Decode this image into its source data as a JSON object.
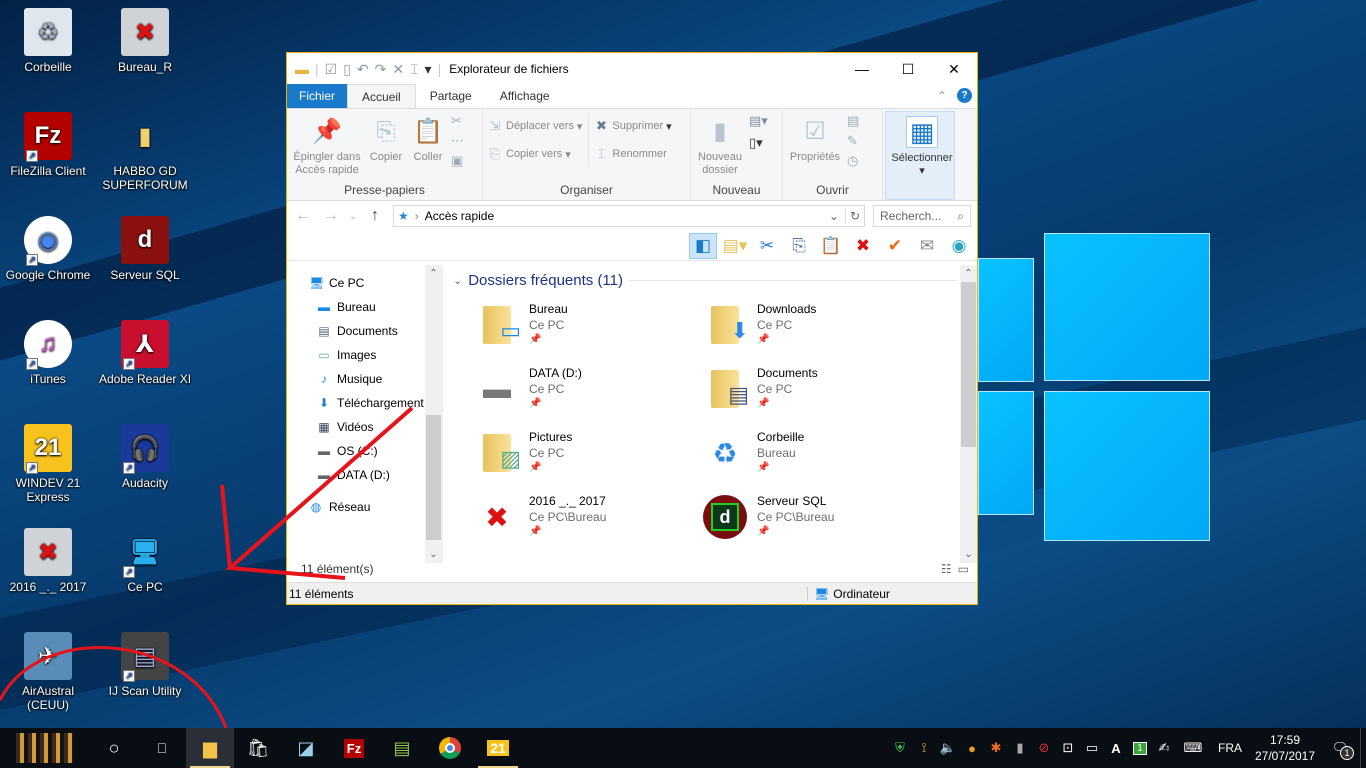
{
  "desktop": {
    "icons": [
      {
        "label": "Corbeille",
        "icon": "recycle-bin-icon",
        "shortcut": false
      },
      {
        "label": "Bureau_R",
        "icon": "disconnected-drive-icon",
        "shortcut": false
      },
      {
        "label": "FileZilla Client",
        "icon": "filezilla-icon",
        "shortcut": true
      },
      {
        "label": "HABBO GD SUPERFORUM",
        "icon": "folder-icon",
        "shortcut": false
      },
      {
        "label": "Google Chrome",
        "icon": "chrome-icon",
        "shortcut": true
      },
      {
        "label": "Serveur SQL",
        "icon": "sql-server-icon",
        "shortcut": false
      },
      {
        "label": "iTunes",
        "icon": "itunes-icon",
        "shortcut": true
      },
      {
        "label": "Adobe Reader XI",
        "icon": "adobe-reader-icon",
        "shortcut": true
      },
      {
        "label": "WINDEV 21 Express",
        "icon": "windev-icon",
        "shortcut": true
      },
      {
        "label": "Audacity",
        "icon": "audacity-icon",
        "shortcut": true
      },
      {
        "label": "2016 _._ 2017",
        "icon": "disconnected-drive-icon",
        "shortcut": false
      },
      {
        "label": "Ce PC",
        "icon": "computer-icon",
        "shortcut": true
      },
      {
        "label": "AirAustral (CEUU)",
        "icon": "airplane-icon",
        "shortcut": false
      },
      {
        "label": "IJ Scan Utility",
        "icon": "scanner-icon",
        "shortcut": true
      }
    ]
  },
  "explorer": {
    "title": "Explorateur de fichiers",
    "tabs": {
      "file": "Fichier",
      "home": "Accueil",
      "share": "Partage",
      "view": "Affichage"
    },
    "ribbon": {
      "clipboard": {
        "pin": "Épingler dans Accès rapide",
        "copy": "Copier",
        "paste": "Coller",
        "label": "Presse-papiers"
      },
      "organize": {
        "move_to": "Déplacer vers",
        "copy_to": "Copier vers",
        "delete": "Supprimer",
        "rename": "Renommer",
        "label": "Organiser"
      },
      "new": {
        "new_folder": "Nouveau dossier",
        "label": "Nouveau"
      },
      "open": {
        "properties": "Propriétés",
        "label": "Ouvrir"
      },
      "select": {
        "select": "Sélectionner"
      }
    },
    "address": {
      "path": "Accès rapide",
      "search_placeholder": "Recherch..."
    },
    "nav_pane": [
      {
        "label": "Ce PC",
        "icon": "computer-icon",
        "level": 0
      },
      {
        "label": "Bureau",
        "icon": "desktop-icon",
        "level": 1
      },
      {
        "label": "Documents",
        "icon": "documents-icon",
        "level": 1
      },
      {
        "label": "Images",
        "icon": "pictures-icon",
        "level": 1
      },
      {
        "label": "Musique",
        "icon": "music-icon",
        "level": 1
      },
      {
        "label": "Téléchargement",
        "icon": "download-icon",
        "level": 1
      },
      {
        "label": "Vidéos",
        "icon": "videos-icon",
        "level": 1
      },
      {
        "label": "OS (C:)",
        "icon": "drive-icon",
        "level": 1
      },
      {
        "label": "DATA (D:)",
        "icon": "drive-icon",
        "level": 1
      },
      {
        "label": "Réseau",
        "icon": "network-icon",
        "level": 0
      }
    ],
    "section_title": "Dossiers fréquents (11)",
    "frequent_folders": [
      {
        "name": "Bureau",
        "location": "Ce PC",
        "icon": "desktop-folder-icon"
      },
      {
        "name": "Downloads",
        "location": "Ce PC",
        "icon": "downloads-folder-icon"
      },
      {
        "name": "DATA (D:)",
        "location": "Ce PC",
        "icon": "drive-icon"
      },
      {
        "name": "Documents",
        "location": "Ce PC",
        "icon": "documents-folder-icon"
      },
      {
        "name": "Pictures",
        "location": "Ce PC",
        "icon": "pictures-folder-icon"
      },
      {
        "name": "Corbeille",
        "location": "Bureau",
        "icon": "recycle-bin-icon"
      },
      {
        "name": "2016 _._ 2017",
        "location": "Ce PC\\Bureau",
        "icon": "disconnected-drive-icon"
      },
      {
        "name": "Serveur SQL",
        "location": "Ce PC\\Bureau",
        "icon": "sql-server-icon"
      }
    ],
    "item_count_inner": "11 élément(s)",
    "status": {
      "count": "11 éléments",
      "zone": "Ordinateur"
    }
  },
  "taskbar": {
    "apps": [
      "start",
      "cortana",
      "task-view",
      "file-explorer",
      "store",
      "notepad",
      "filezilla",
      "notepadpp",
      "chrome",
      "windev"
    ],
    "tray": {
      "language": "FRA",
      "time": "17:59",
      "date": "27/07/2017",
      "notifications": "1",
      "ime": "A"
    }
  }
}
